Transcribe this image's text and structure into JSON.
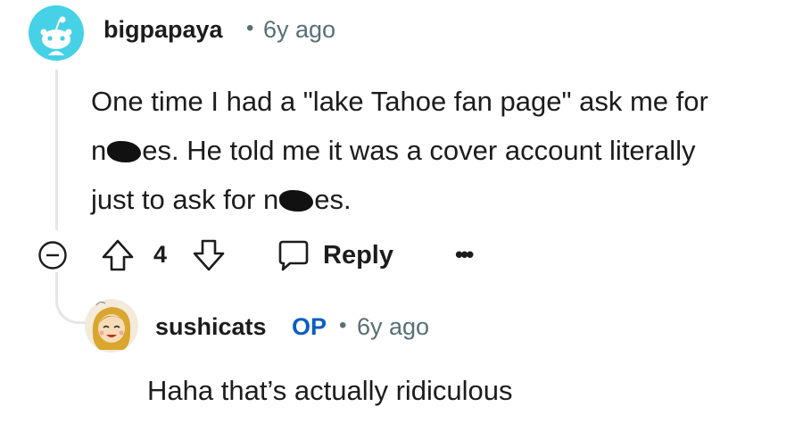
{
  "comment": {
    "author": "bigpapaya",
    "separator": "•",
    "time": "6y ago",
    "body_lines": [
      [
        "One time I had a \"lake Tahoe fan page\" ask me for"
      ],
      [
        "n",
        "es. He told me it was a cover account literally"
      ],
      [
        "just to ask for n",
        "es."
      ]
    ],
    "score": "4",
    "reply_label": "Reply",
    "more_label": "•••",
    "colors": {
      "avatar": "#46d1e6",
      "meta": "#576f76",
      "thread": "#e4e6e8"
    }
  },
  "reply": {
    "author": "sushicats",
    "op_badge": "OP",
    "separator": "•",
    "time": "6y ago",
    "body": "Haha that’s actually ridiculous",
    "colors": {
      "op": "#0a5dc2"
    }
  },
  "icons": {
    "avatar_top": "reddit-snoo-avatar",
    "collapse": "minus-circle-icon",
    "upvote": "arrow-up-icon",
    "downvote": "arrow-down-icon",
    "reply": "speech-bubble-icon",
    "avatar_reply": "cartoon-face-avatar"
  }
}
